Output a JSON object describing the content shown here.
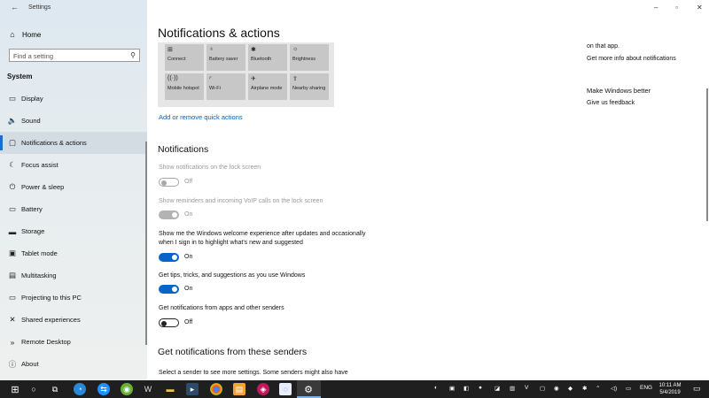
{
  "window": {
    "title": "Settings",
    "controls": {
      "minimize": "–",
      "maximize": "▫",
      "close": "✕"
    }
  },
  "sidebar": {
    "home_label": "Home",
    "search_placeholder": "Find a setting",
    "section_label": "System",
    "items": [
      {
        "label": "Display",
        "icon": "display-icon",
        "glyph": "▭"
      },
      {
        "label": "Sound",
        "icon": "sound-icon",
        "glyph": "🔈"
      },
      {
        "label": "Notifications & actions",
        "icon": "notifications-icon",
        "glyph": "▢",
        "active": true
      },
      {
        "label": "Focus assist",
        "icon": "focus-assist-icon",
        "glyph": "☾"
      },
      {
        "label": "Power & sleep",
        "icon": "power-icon",
        "glyph": "⏻"
      },
      {
        "label": "Battery",
        "icon": "battery-icon",
        "glyph": "▭"
      },
      {
        "label": "Storage",
        "icon": "storage-icon",
        "glyph": "▬"
      },
      {
        "label": "Tablet mode",
        "icon": "tablet-mode-icon",
        "glyph": "▣"
      },
      {
        "label": "Multitasking",
        "icon": "multitasking-icon",
        "glyph": "▤"
      },
      {
        "label": "Projecting to this PC",
        "icon": "projecting-icon",
        "glyph": "▭"
      },
      {
        "label": "Shared experiences",
        "icon": "shared-experiences-icon",
        "glyph": "✕"
      },
      {
        "label": "Remote Desktop",
        "icon": "remote-desktop-icon",
        "glyph": "»"
      },
      {
        "label": "About",
        "icon": "about-icon",
        "glyph": "ⓘ"
      }
    ]
  },
  "main": {
    "title": "Notifications & actions",
    "quick_actions": [
      {
        "label": "Connect",
        "icon": "connect-icon",
        "glyph": "⊞"
      },
      {
        "label": "Battery saver",
        "icon": "battery-saver-icon",
        "glyph": "♁"
      },
      {
        "label": "Bluetooth",
        "icon": "bluetooth-icon",
        "glyph": "✱"
      },
      {
        "label": "Brightness",
        "icon": "brightness-icon",
        "glyph": "☼"
      },
      {
        "label": "Mobile hotspot",
        "icon": "mobile-hotspot-icon",
        "glyph": "((·))"
      },
      {
        "label": "Wi-Fi",
        "icon": "wifi-icon",
        "glyph": "◜"
      },
      {
        "label": "Airplane mode",
        "icon": "airplane-icon",
        "glyph": "✈"
      },
      {
        "label": "Nearby sharing",
        "icon": "nearby-sharing-icon",
        "glyph": "⇪"
      }
    ],
    "quick_actions_link": "Add or remove quick actions",
    "notifications_heading": "Notifications",
    "settings": [
      {
        "label": "Show notifications on the lock screen",
        "state": "Off",
        "on": false,
        "disabled": true
      },
      {
        "label": "Show reminders and incoming VoIP calls on the lock screen",
        "state": "On",
        "on": true,
        "disabled": true
      },
      {
        "label": "Show me the Windows welcome experience after updates and occasionally when I sign in to highlight what's new and suggested",
        "state": "On",
        "on": true,
        "disabled": false
      },
      {
        "label": "Get tips, tricks, and suggestions as you use Windows",
        "state": "On",
        "on": true,
        "disabled": false
      },
      {
        "label": "Get notifications from apps and other senders",
        "state": "Off",
        "on": false,
        "disabled": false
      }
    ],
    "senders_heading": "Get notifications from these senders",
    "senders_desc": "Select a sender to see more settings. Some senders might also have"
  },
  "right": {
    "on_that_app": "on that app.",
    "more_info_link": "Get more info about notifications",
    "make_better": "Make Windows better",
    "feedback_link": "Give us feedback"
  },
  "taskbar": {
    "language": "ENG",
    "time": "10:11 AM",
    "date": "5/4/2019"
  }
}
